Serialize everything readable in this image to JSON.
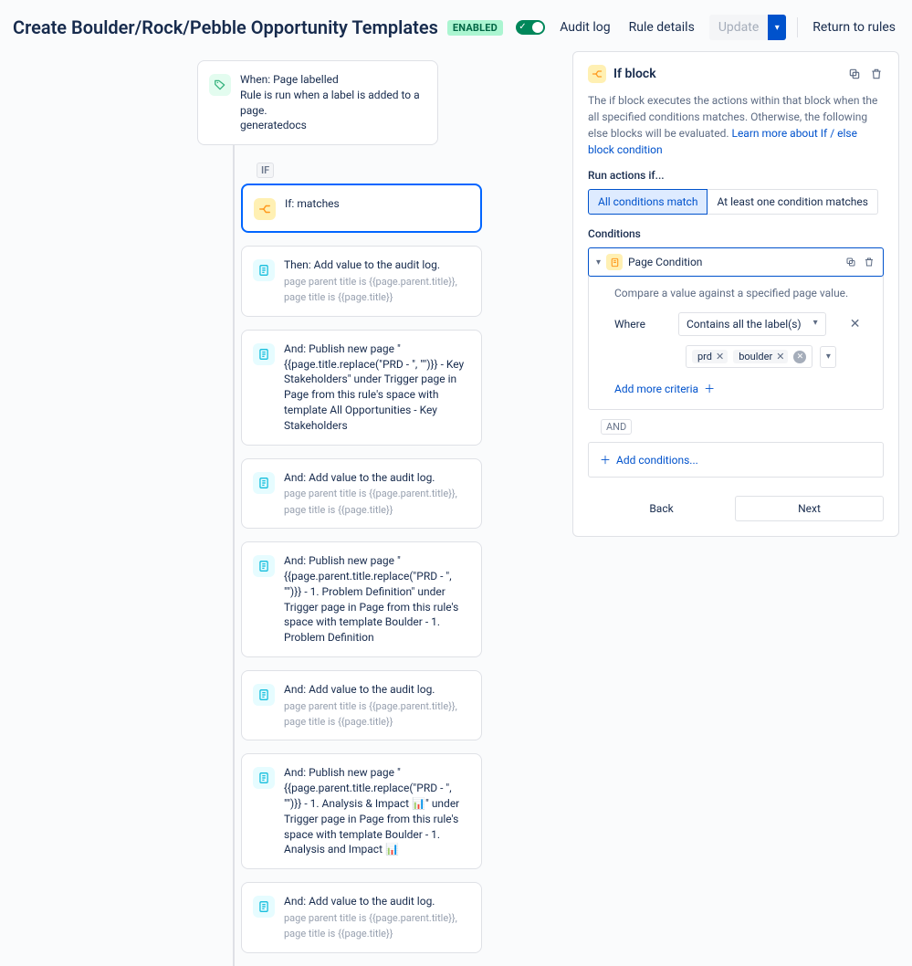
{
  "header": {
    "title": "Create Boulder/Rock/Pebble Opportunity Templates",
    "enabled_badge": "ENABLED",
    "audit_log": "Audit log",
    "rule_details": "Rule details",
    "update": "Update",
    "return": "Return to rules"
  },
  "flow": {
    "trigger": {
      "line1": "When: Page labelled",
      "line2": "Rule is run when a label is added to a page.",
      "line3": "generatedocs"
    },
    "if_badge": "IF",
    "if_block": {
      "label": "If: matches"
    },
    "steps": [
      {
        "main": "Then: Add value to the audit log.",
        "sub1": "page parent title is {{page.parent.title}},",
        "sub2": "page title is {{page.title}}"
      },
      {
        "main": "And: Publish new page \"{{page.title.replace(\"PRD - \", \"\")}} - Key Stakeholders\" under Trigger page in Page from this rule's space with template All Opportunities - Key Stakeholders",
        "sub1": "",
        "sub2": ""
      },
      {
        "main": "And: Add value to the audit log.",
        "sub1": "page parent title is {{page.parent.title}},",
        "sub2": "page title is {{page.title}}"
      },
      {
        "main": "And: Publish new page \"{{page.parent.title.replace(\"PRD - \", \"\")}} - 1. Problem Definition\" under Trigger page in Page from this rule's space with template Boulder - 1. Problem Definition",
        "sub1": "",
        "sub2": ""
      },
      {
        "main": "And: Add value to the audit log.",
        "sub1": "page parent title is {{page.parent.title}},",
        "sub2": "page title is {{page.title}}"
      },
      {
        "main": "And: Publish new page \"{{page.parent.title.replace(\"PRD - \", \"\")}} - 1. Analysis & Impact 📊\" under Trigger page in Page from this rule's space with template Boulder - 1. Analysis and Impact 📊",
        "sub1": "",
        "sub2": ""
      },
      {
        "main": "And: Add value to the audit log.",
        "sub1": "page parent title is {{page.parent.title}},",
        "sub2": "page title is {{page.title}}"
      }
    ]
  },
  "panel": {
    "title": "If block",
    "desc_main": "The if block executes the actions within that block when the all specified conditions matches. Otherwise, the following else blocks will be evaluated. ",
    "desc_link": "Learn more about If / else block condition",
    "run_if": "Run actions if...",
    "opt_all": "All conditions match",
    "opt_any": "At least one condition matches",
    "conditions_label": "Conditions",
    "cond_name": "Page Condition",
    "cond_help": "Compare a value against a specified page value.",
    "where": "Where",
    "operator": "Contains all the label(s)",
    "labels": {
      "l1": "prd",
      "l2": "boulder"
    },
    "add_criteria": "Add more criteria",
    "and_label": "AND",
    "add_conditions": "Add conditions...",
    "back": "Back",
    "next": "Next"
  }
}
